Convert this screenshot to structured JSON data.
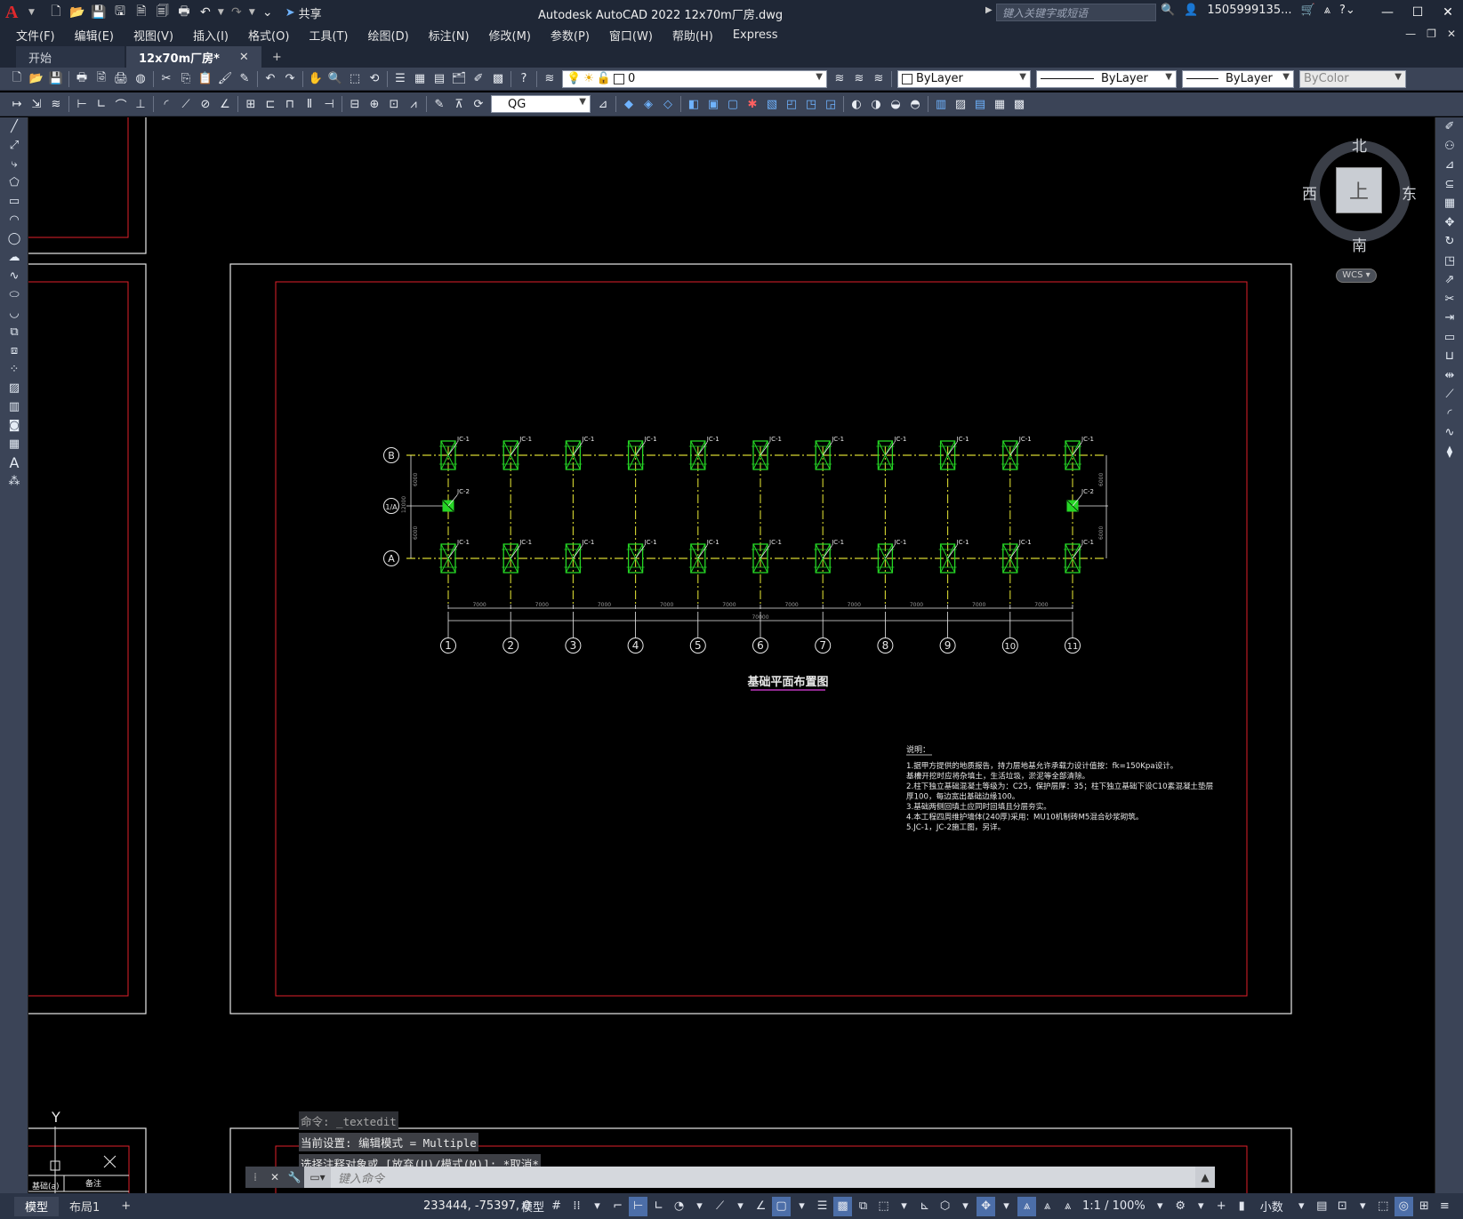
{
  "titlebar": {
    "app_logo": "A",
    "share_label": "共享",
    "title": "Autodesk AutoCAD 2022    12x70m厂房.dwg",
    "search_placeholder": "键入关键字或短语",
    "user": "1505999135...",
    "icons": [
      "new-icon",
      "open-icon",
      "save-icon",
      "saveas-icon",
      "web-save-icon",
      "plot-icon",
      "undo-icon",
      "redo-icon",
      "customize-icon"
    ]
  },
  "menu": [
    "文件(F)",
    "编辑(E)",
    "视图(V)",
    "插入(I)",
    "格式(O)",
    "工具(T)",
    "绘图(D)",
    "标注(N)",
    "修改(M)",
    "参数(P)",
    "窗口(W)",
    "帮助(H)",
    "Express"
  ],
  "tabs": {
    "start": "开始",
    "active": "12x70m厂房*",
    "plus": "+"
  },
  "toolbar": {
    "layer_value": "0",
    "color_value": "ByLayer",
    "linetype_value": "ByLayer",
    "lineweight_value": "ByLayer",
    "plotstyle_value": "ByColor",
    "dimstyle_value": "QG"
  },
  "viewcube": {
    "north": "北",
    "south": "南",
    "east": "东",
    "west": "西",
    "top": "上",
    "wcs": "WCS"
  },
  "drawing": {
    "title": "基础平面布置图",
    "row_labels": [
      "B",
      "1/A",
      "A"
    ],
    "column_labels": [
      "1",
      "2",
      "3",
      "4",
      "5",
      "6",
      "7",
      "8",
      "9",
      "10",
      "11"
    ],
    "span_labels": [
      "7000",
      "7000",
      "7000",
      "7000",
      "7000",
      "7000",
      "7000",
      "7000",
      "7000",
      "7000"
    ],
    "total_label": "70000",
    "footing_jc1": "JC-1",
    "footing_jc2": "JC-2",
    "side_dims": [
      "6000",
      "6000",
      "12000"
    ],
    "notes_title": "说明：",
    "notes": [
      "1.据甲方提供的地质报告，持力层地基允许承载力设计值按：fk=150Kpa设计。",
      "  基槽开挖时应将杂填土，生活垃圾，淤泥等全部清除。",
      "2.柱下独立基础混凝土等级为：C25，保护层厚：35；柱下独立基础下设C10素混凝土垫层",
      "  厚100，每边宽出基础边缘100。",
      "3.基础两侧回填土应同时回填且分层夯实。",
      "4.本工程四周维护墙体(240厚)采用：MU10机制砖M5混合砂浆砌筑。",
      "5.JC-1，JC-2施工图，另详。"
    ],
    "mini_labels": [
      "基础(a)",
      "备注"
    ],
    "ucs_y": "Y"
  },
  "command": {
    "history": [
      "命令: _textedit",
      "当前设置: 编辑模式 = Multiple",
      "选择注释对象或 [放弃(U)/模式(M)]: *取消*"
    ],
    "placeholder": "键入命令"
  },
  "status": {
    "model_tab": "模型",
    "layout_tab": "布局1",
    "coords": "233444, -75397, 0",
    "model_btn": "模型",
    "scale": "1:1 / 100%",
    "units": "小数"
  },
  "colors": {
    "bg_ui": "#3b4457",
    "bg_title": "#1f2736",
    "frame_red": "#e0202a",
    "grid_yellow": "#d6d630",
    "footing_green": "#25d625"
  }
}
